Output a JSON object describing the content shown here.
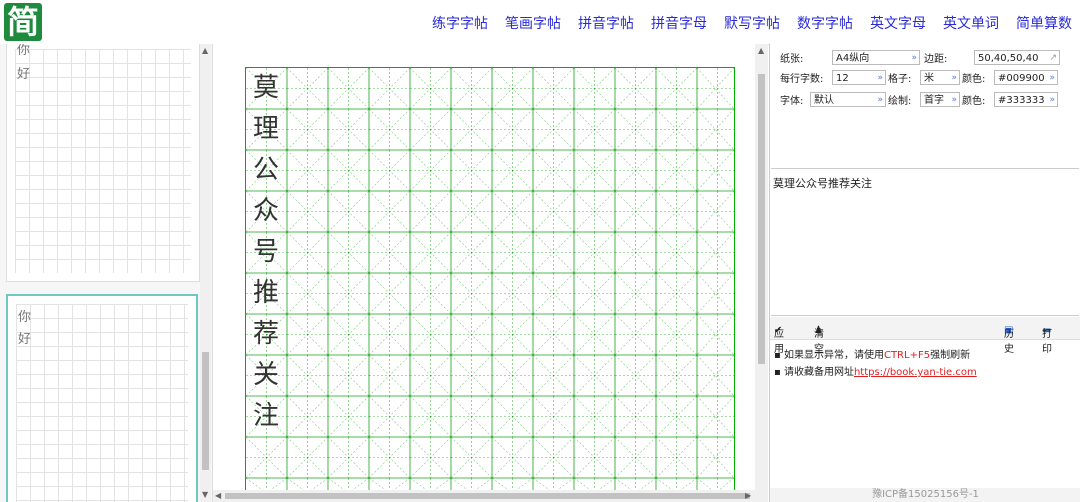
{
  "header": {
    "logo_char": "简",
    "nav": [
      "练字字帖",
      "笔画字帖",
      "拼音字帖",
      "拼音字母",
      "默写字帖",
      "数字字帖",
      "英文字母",
      "英文单词",
      "简单算数"
    ]
  },
  "thumbnails": [
    {
      "chars": [
        "你",
        "好"
      ]
    },
    {
      "chars": [
        "你",
        "好"
      ]
    }
  ],
  "settings": {
    "paper_label": "纸张:",
    "paper_value": "A4纵向",
    "margin_label": "边距:",
    "margin_value": "50,40,50,40",
    "per_row_label": "每行字数:",
    "per_row_value": "12",
    "grid_label": "格子:",
    "grid_value": "米",
    "grid_color_label": "颜色:",
    "grid_color_value": "#009900",
    "font_label": "字体:",
    "font_value": "默认",
    "draw_label": "绘制:",
    "draw_value": "首字",
    "text_color_label": "颜色:",
    "text_color_value": "#333333"
  },
  "input_text": "莫理公众号推荐关注",
  "toolbar": {
    "apply": "应用",
    "clear": "清空",
    "history": "历史",
    "print": "打印"
  },
  "notes": {
    "note1_prefix": "如果显示异常，请使用",
    "note1_key": "CTRL+F5",
    "note1_suffix": "强制刷新",
    "note2_prefix": "请收藏备用网址",
    "note2_link": "https://book.yan-tie.com"
  },
  "footer": "豫ICP备15025156号-1",
  "paper_chars": [
    "莫",
    "理",
    "公",
    "众",
    "号",
    "推",
    "荐",
    "关",
    "注"
  ],
  "colors": {
    "grid": "#009900",
    "text": "#333333",
    "nav": "#2b2bd6",
    "brand": "#1d8a3c"
  }
}
